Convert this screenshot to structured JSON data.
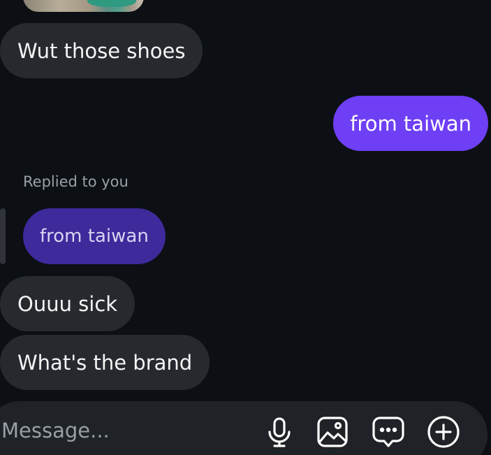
{
  "thread": {
    "messages": [
      {
        "sender": "other",
        "text": "Wut those shoes"
      },
      {
        "sender": "me",
        "text": "from taiwan"
      },
      {
        "sender": "other",
        "reply_label": "Replied to you",
        "quoted_text": "from taiwan",
        "text": "Ouuu sick"
      },
      {
        "sender": "other",
        "text": "What's the brand"
      }
    ]
  },
  "composer": {
    "placeholder": "Message...",
    "icons": [
      "microphone-icon",
      "gallery-icon",
      "sticker-chat-icon",
      "add-icon"
    ]
  },
  "colors": {
    "background": "#0c1014",
    "incoming_bubble": "#262a2f",
    "outgoing_bubble": "#6e3ff4",
    "quoted_bubble": "#3f2a9c"
  }
}
